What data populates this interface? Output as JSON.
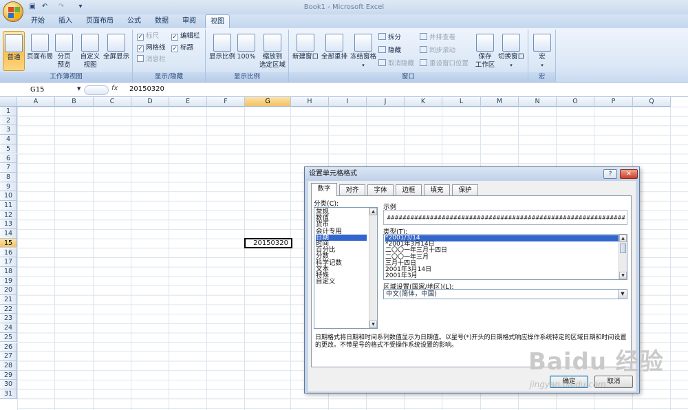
{
  "window": {
    "title": "Book1 - Microsoft Excel"
  },
  "tabs": [
    "开始",
    "插入",
    "页面布局",
    "公式",
    "数据",
    "审阅",
    "视图"
  ],
  "active_tab": "视图",
  "ribbon": {
    "workbook_views": {
      "label": "工作簿视图",
      "normal": "普通",
      "page_layout": "页面布局",
      "page_break_1": "分页",
      "page_break_2": "预览",
      "custom_1": "自定义",
      "custom_2": "视图",
      "fullscreen": "全屏显示"
    },
    "show_hide": {
      "label": "显示/隐藏",
      "ruler": "标尺",
      "formula_bar": "编辑栏",
      "gridlines": "网格线",
      "headings": "标题",
      "message_bar": "消息栏"
    },
    "zoom": {
      "label": "显示比例",
      "zoom": "显示比例",
      "hundred": "100%",
      "zoom_sel_1": "缩放到",
      "zoom_sel_2": "选定区域"
    },
    "window": {
      "label": "窗口",
      "new_window": "新建窗口",
      "arrange_all": "全部重排",
      "freeze": "冻结窗格",
      "split": "拆分",
      "hide": "隐藏",
      "unhide": "取消隐藏",
      "side_by_side": "并排查看",
      "sync_scroll": "同步滚动",
      "reset_pos": "重设窗口位置",
      "save_ws_1": "保存",
      "save_ws_2": "工作区",
      "switch": "切换窗口"
    },
    "macros": {
      "label": "宏",
      "macros": "宏"
    }
  },
  "formula_bar": {
    "name_box": "G15",
    "fx": "fx",
    "value": "20150320"
  },
  "columns": [
    "A",
    "B",
    "C",
    "D",
    "E",
    "F",
    "G",
    "H",
    "I",
    "J",
    "K",
    "L",
    "M",
    "N",
    "O",
    "P",
    "Q"
  ],
  "rows": [
    "1",
    "2",
    "3",
    "4",
    "5",
    "6",
    "7",
    "8",
    "9",
    "10",
    "11",
    "12",
    "13",
    "14",
    "15",
    "16",
    "17",
    "18",
    "19",
    "20",
    "21",
    "22",
    "23",
    "24",
    "25",
    "26",
    "27",
    "28",
    "29",
    "30",
    "31"
  ],
  "active_cell": {
    "ref": "G15",
    "value": "20150320"
  },
  "dialog": {
    "title": "设置单元格格式",
    "help": "?",
    "close": "✕",
    "tabs": [
      "数字",
      "对齐",
      "字体",
      "边框",
      "填充",
      "保护"
    ],
    "category_label": "分类(C):",
    "categories": [
      "常规",
      "数值",
      "货币",
      "会计专用",
      "日期",
      "时间",
      "百分比",
      "分数",
      "科学记数",
      "文本",
      "特殊",
      "自定义"
    ],
    "selected_category": "日期",
    "sample_label": "示例",
    "sample_value": "########################################################################",
    "type_label": "类型(T):",
    "types": [
      "*2001/3/14",
      "*2001年3月14日",
      "二〇〇一年三月十四日",
      "二〇〇一年三月",
      "三月十四日",
      "2001年3月14日",
      "2001年3月"
    ],
    "selected_type": "*2001/3/14",
    "locale_label": "区域设置(国家/地区)(L):",
    "locale_value": "中文(简体，中国)",
    "description": "日期格式将日期和时间系列数值显示为日期值。以星号(*)开头的日期格式响应操作系统特定的区域日期和时间设置的更改。不带星号的格式不受操作系统设置的影响。",
    "ok": "确定",
    "cancel": "取消"
  },
  "watermark": {
    "text": "Baidu 经验",
    "sub": "jingyan.baidu.com"
  }
}
